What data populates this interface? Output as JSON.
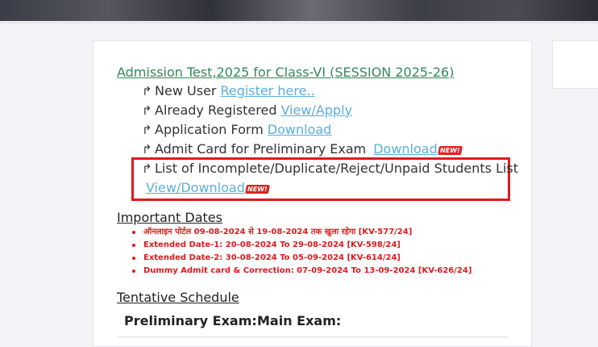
{
  "admission": {
    "title": "Admission Test,2025 for Class-VI (SESSION 2025-26)",
    "items": [
      {
        "text": "New User",
        "link": "Register here..",
        "new": false
      },
      {
        "text": "Already Registered",
        "link": "View/Apply",
        "new": false
      },
      {
        "text": "Application Form",
        "link": "Download",
        "new": false
      },
      {
        "text": "Admit Card for Preliminary Exam",
        "link": "Download",
        "new": true
      },
      {
        "text": "List of Incomplete/Duplicate/Reject/Unpaid Students List",
        "link": "View/Download",
        "new": true
      }
    ],
    "new_badge": "NEW!"
  },
  "important_dates": {
    "title": "Important Dates",
    "items": [
      "ऑनलाइन पोर्टल 09-08-2024 से 19-08-2024 तक खुला रहेगा [KV-577/24]",
      "Extended Date-1: 20-08-2024 To 29-08-2024 [KV-598/24]",
      "Extended Date-2: 30-08-2024 To 05-09-2024 [KV-614/24]",
      "Dummy Admit card & Correction: 07-09-2024 To 13-09-2024 [KV-626/24]"
    ]
  },
  "schedule": {
    "title": "Tentative Schedule",
    "preliminary": "Preliminary Exam:",
    "main": "Main Exam:"
  },
  "colors": {
    "heading_link": "#2f8a5a",
    "link": "#5aaee0",
    "highlight_box": "#e0191e",
    "date_text": "#e0191e"
  },
  "icons": {
    "item_arrow": "arrow-return-icon"
  }
}
